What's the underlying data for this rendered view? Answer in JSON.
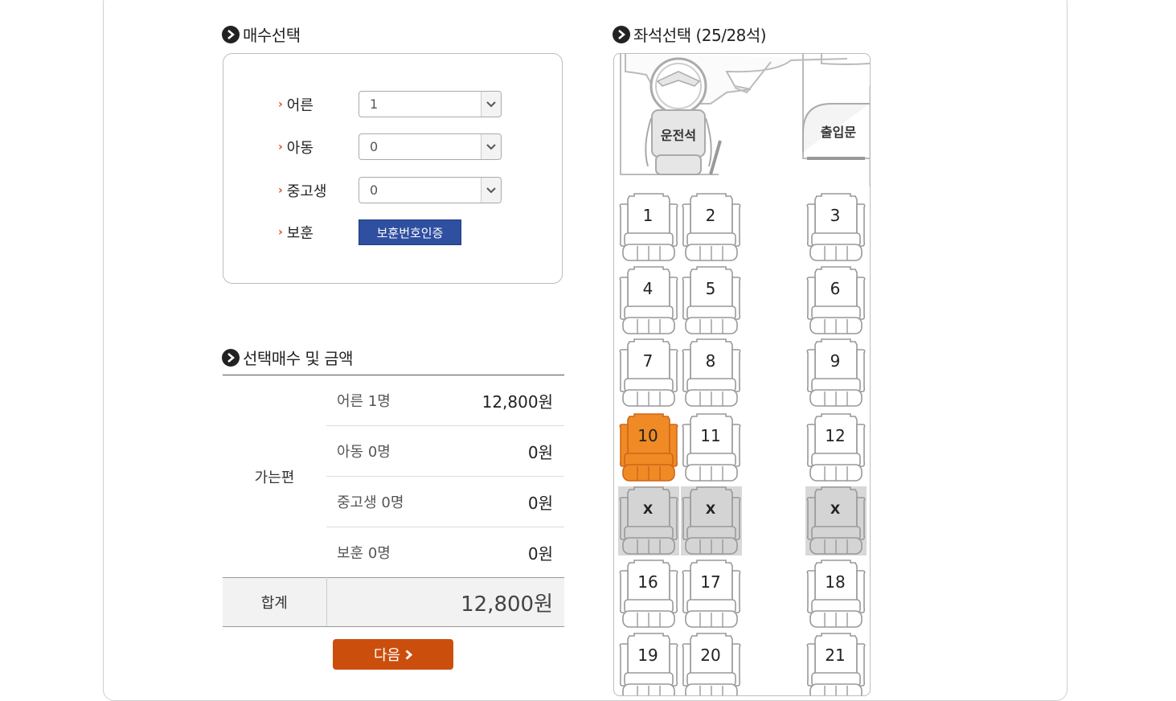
{
  "ticket_section": {
    "title": "매수선택",
    "rows": [
      {
        "label": "어른",
        "value": "1"
      },
      {
        "label": "아동",
        "value": "0"
      },
      {
        "label": "중고생",
        "value": "0"
      }
    ],
    "veteran": {
      "label": "보훈",
      "button": "보훈번호인증"
    }
  },
  "seat_section": {
    "title": "좌석선택 (25/28석)",
    "driver_label": "운전석",
    "door_label": "출입문",
    "seats": [
      {
        "label": "1",
        "state": "available"
      },
      {
        "label": "2",
        "state": "available"
      },
      {
        "label": "3",
        "state": "available"
      },
      {
        "label": "4",
        "state": "available"
      },
      {
        "label": "5",
        "state": "available"
      },
      {
        "label": "6",
        "state": "available"
      },
      {
        "label": "7",
        "state": "available"
      },
      {
        "label": "8",
        "state": "available"
      },
      {
        "label": "9",
        "state": "available"
      },
      {
        "label": "10",
        "state": "selected"
      },
      {
        "label": "11",
        "state": "available"
      },
      {
        "label": "12",
        "state": "available"
      },
      {
        "label": "X",
        "state": "sold"
      },
      {
        "label": "X",
        "state": "sold"
      },
      {
        "label": "X",
        "state": "sold"
      },
      {
        "label": "16",
        "state": "available"
      },
      {
        "label": "17",
        "state": "available"
      },
      {
        "label": "18",
        "state": "available"
      },
      {
        "label": "19",
        "state": "available"
      },
      {
        "label": "20",
        "state": "available"
      },
      {
        "label": "21",
        "state": "available"
      }
    ]
  },
  "summary_section": {
    "title": "선택매수 및 금액",
    "category": "가는편",
    "items": [
      {
        "label": "어른 1명",
        "amount": "12,800원"
      },
      {
        "label": "아동 0명",
        "amount": "0원"
      },
      {
        "label": "중고생 0명",
        "amount": "0원"
      },
      {
        "label": "보훈 0명",
        "amount": "0원"
      }
    ],
    "total_label": "합계",
    "total_amount": "12,800원"
  },
  "next_button": {
    "label": "다음"
  },
  "colors": {
    "accent": "#cc4e0d",
    "selected_seat": "#f08a24",
    "verify_button": "#2f4fa0",
    "sold_seat": "#d8d8d8"
  }
}
